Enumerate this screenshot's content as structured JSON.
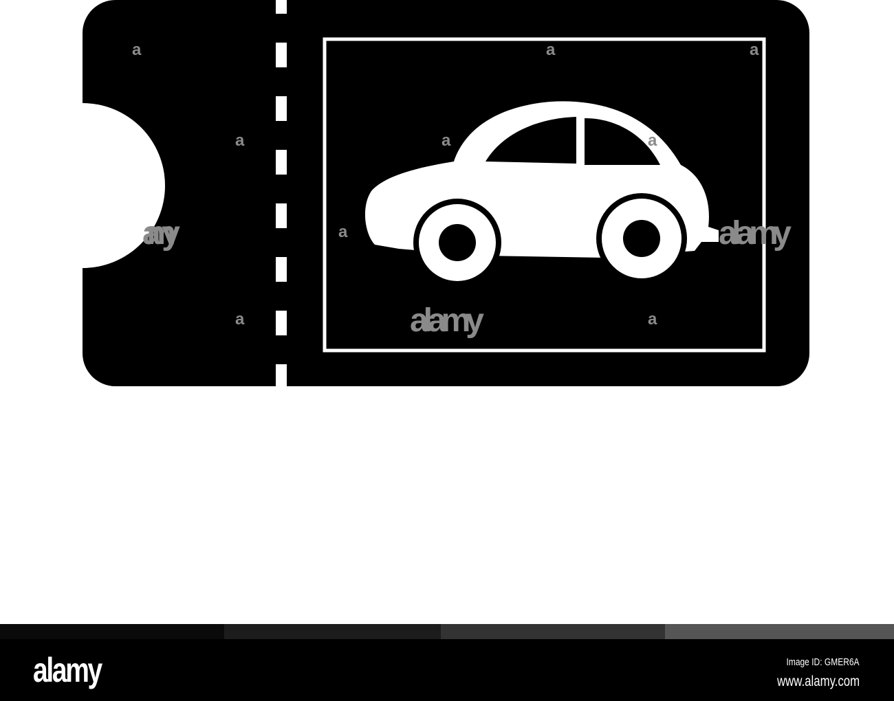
{
  "image": {
    "subject": "ticket-with-car-icon",
    "watermark_text": "alamy"
  },
  "footer": {
    "logo": "alamy",
    "image_id": "Image ID: GMER6A",
    "website": "www.alamy.com"
  },
  "colors": {
    "ticket": "#000000",
    "background": "#ffffff",
    "strip": [
      "#0a0a0a",
      "#1c1c1c",
      "#333333",
      "#555555"
    ]
  }
}
